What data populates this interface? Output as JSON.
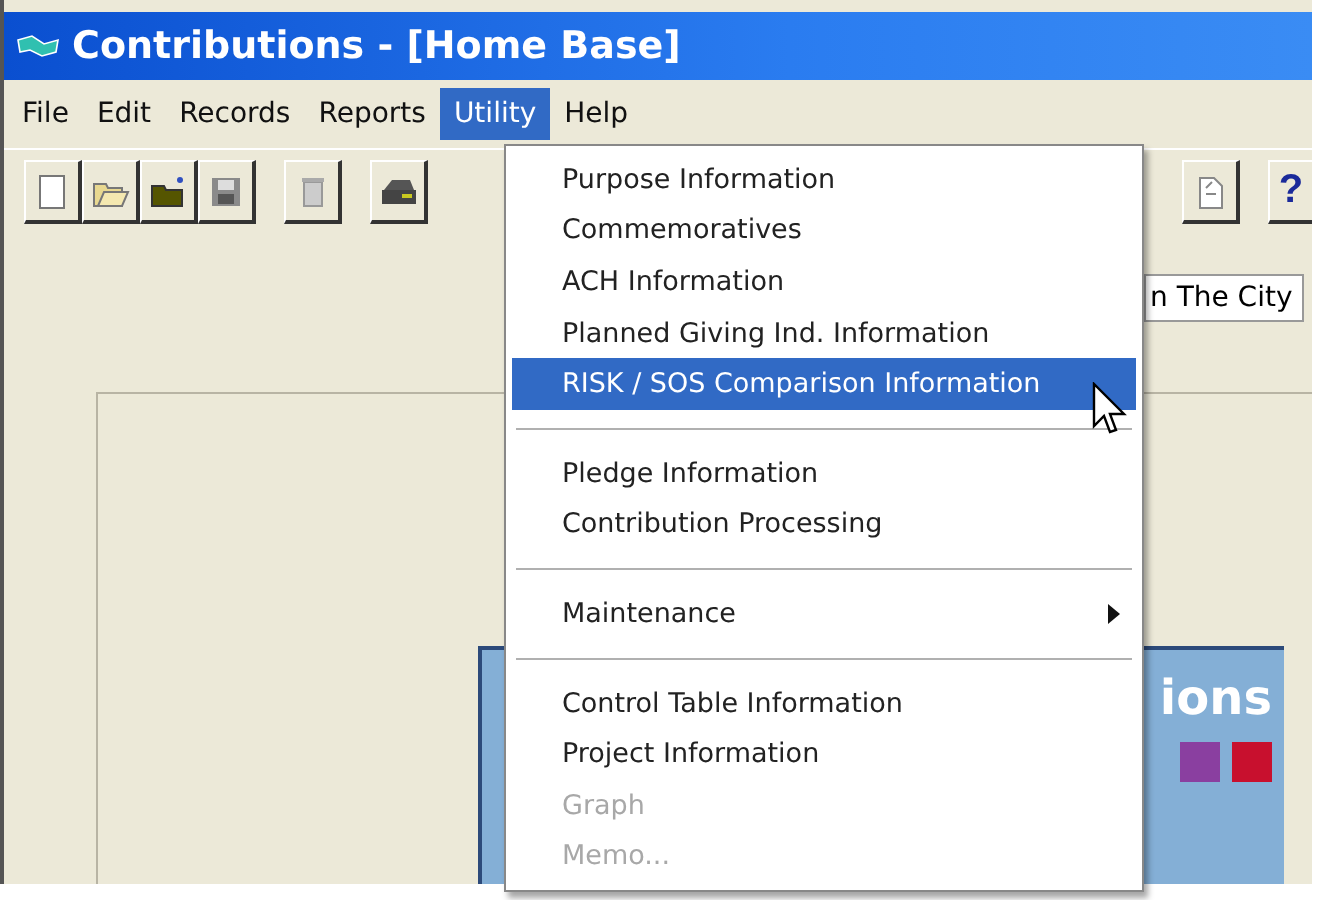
{
  "window": {
    "title": "Contributions - [Home Base]"
  },
  "menu_bar": [
    {
      "label": "File",
      "selected": false
    },
    {
      "label": "Edit",
      "selected": false
    },
    {
      "label": "Records",
      "selected": false
    },
    {
      "label": "Reports",
      "selected": false
    },
    {
      "label": "Utility",
      "selected": true
    },
    {
      "label": "Help",
      "selected": false
    }
  ],
  "toolbar": {
    "help_glyph": "?"
  },
  "location_field": {
    "value": "n The City"
  },
  "banner": {
    "text": "ions"
  },
  "utility_menu": [
    {
      "kind": "item",
      "label": "Purpose Information",
      "selected": false,
      "disabled": false
    },
    {
      "kind": "item",
      "label": "Commemoratives",
      "selected": false,
      "disabled": false
    },
    {
      "kind": "item",
      "label": "ACH Information",
      "selected": false,
      "disabled": false
    },
    {
      "kind": "item",
      "label": "Planned Giving Ind. Information",
      "selected": false,
      "disabled": false
    },
    {
      "kind": "item",
      "label": "RISK / SOS Comparison Information",
      "selected": true,
      "disabled": false
    },
    {
      "kind": "separator"
    },
    {
      "kind": "item",
      "label": "Pledge Information",
      "selected": false,
      "disabled": false
    },
    {
      "kind": "item",
      "label": "Contribution Processing",
      "selected": false,
      "disabled": false
    },
    {
      "kind": "separator"
    },
    {
      "kind": "submenu",
      "label": "Maintenance",
      "selected": false,
      "disabled": false
    },
    {
      "kind": "separator"
    },
    {
      "kind": "item",
      "label": "Control Table Information",
      "selected": false,
      "disabled": false
    },
    {
      "kind": "item",
      "label": "Project Information",
      "selected": false,
      "disabled": false
    },
    {
      "kind": "item",
      "label": "Graph",
      "selected": false,
      "disabled": true
    },
    {
      "kind": "item",
      "label": "Memo...",
      "selected": false,
      "disabled": true
    }
  ]
}
